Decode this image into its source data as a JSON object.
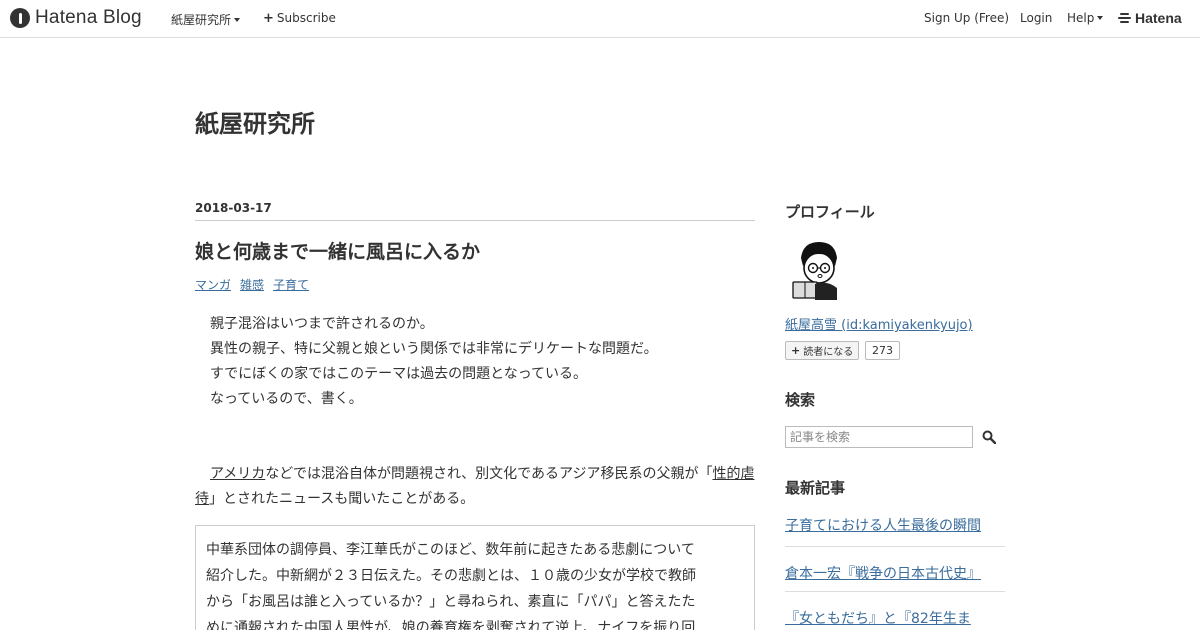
{
  "header": {
    "logo": "Hatena Blog",
    "blog_menu": "紙屋研究所",
    "subscribe": "Subscribe",
    "signup": "Sign Up (Free)",
    "login": "Login",
    "help": "Help",
    "hatena": "Hatena"
  },
  "blog": {
    "title": "紙屋研究所"
  },
  "entry": {
    "date": "2018-03-17",
    "title": "娘と何歳まで一緒に風呂に入るか",
    "categories": [
      "マンガ",
      "雑感",
      "子育て"
    ],
    "p1": [
      "親子混浴はいつまで許されるのか。",
      "異性の親子、特に父親と娘という関係では非常にデリケートな問題だ。",
      "すでにぼくの家ではこのテーマは過去の問題となっている。",
      "なっているので、書く。"
    ],
    "p2_link": "アメリカ",
    "p2_a": "などでは混浴自体が問題視され、別文化であるアジア移民系の父親が「",
    "p2_link2": "性的虐待",
    "p2_b": "」とされたニュースも聞いたことがある。",
    "quote": [
      "中華系団体の調停員、李江華氏がこのほど、数年前に起きたある悲劇について",
      "紹介した。中新網が２３日伝えた。その悲劇とは、１０歳の少女が学校で教師",
      "から「お風呂は誰と入っているか？」と尋ねられ、素直に「パパ」と答えたた",
      "めに通報された中国人男性が、娘の養育権を剥奪されて逆上、ナイフを振り回"
    ]
  },
  "sidebar": {
    "profile_heading": "プロフィール",
    "profile_name": "紙屋高雪 (id:kamiyakenkyujo)",
    "reader_button": "読者になる",
    "reader_count": "273",
    "search_heading": "検索",
    "search_placeholder": "記事を検索",
    "recent_heading": "最新記事",
    "recent": [
      "子育てにおける人生最後の瞬間",
      "倉本一宏『戦争の日本古代史』",
      "『女ともだち』と『82年生ま"
    ]
  }
}
